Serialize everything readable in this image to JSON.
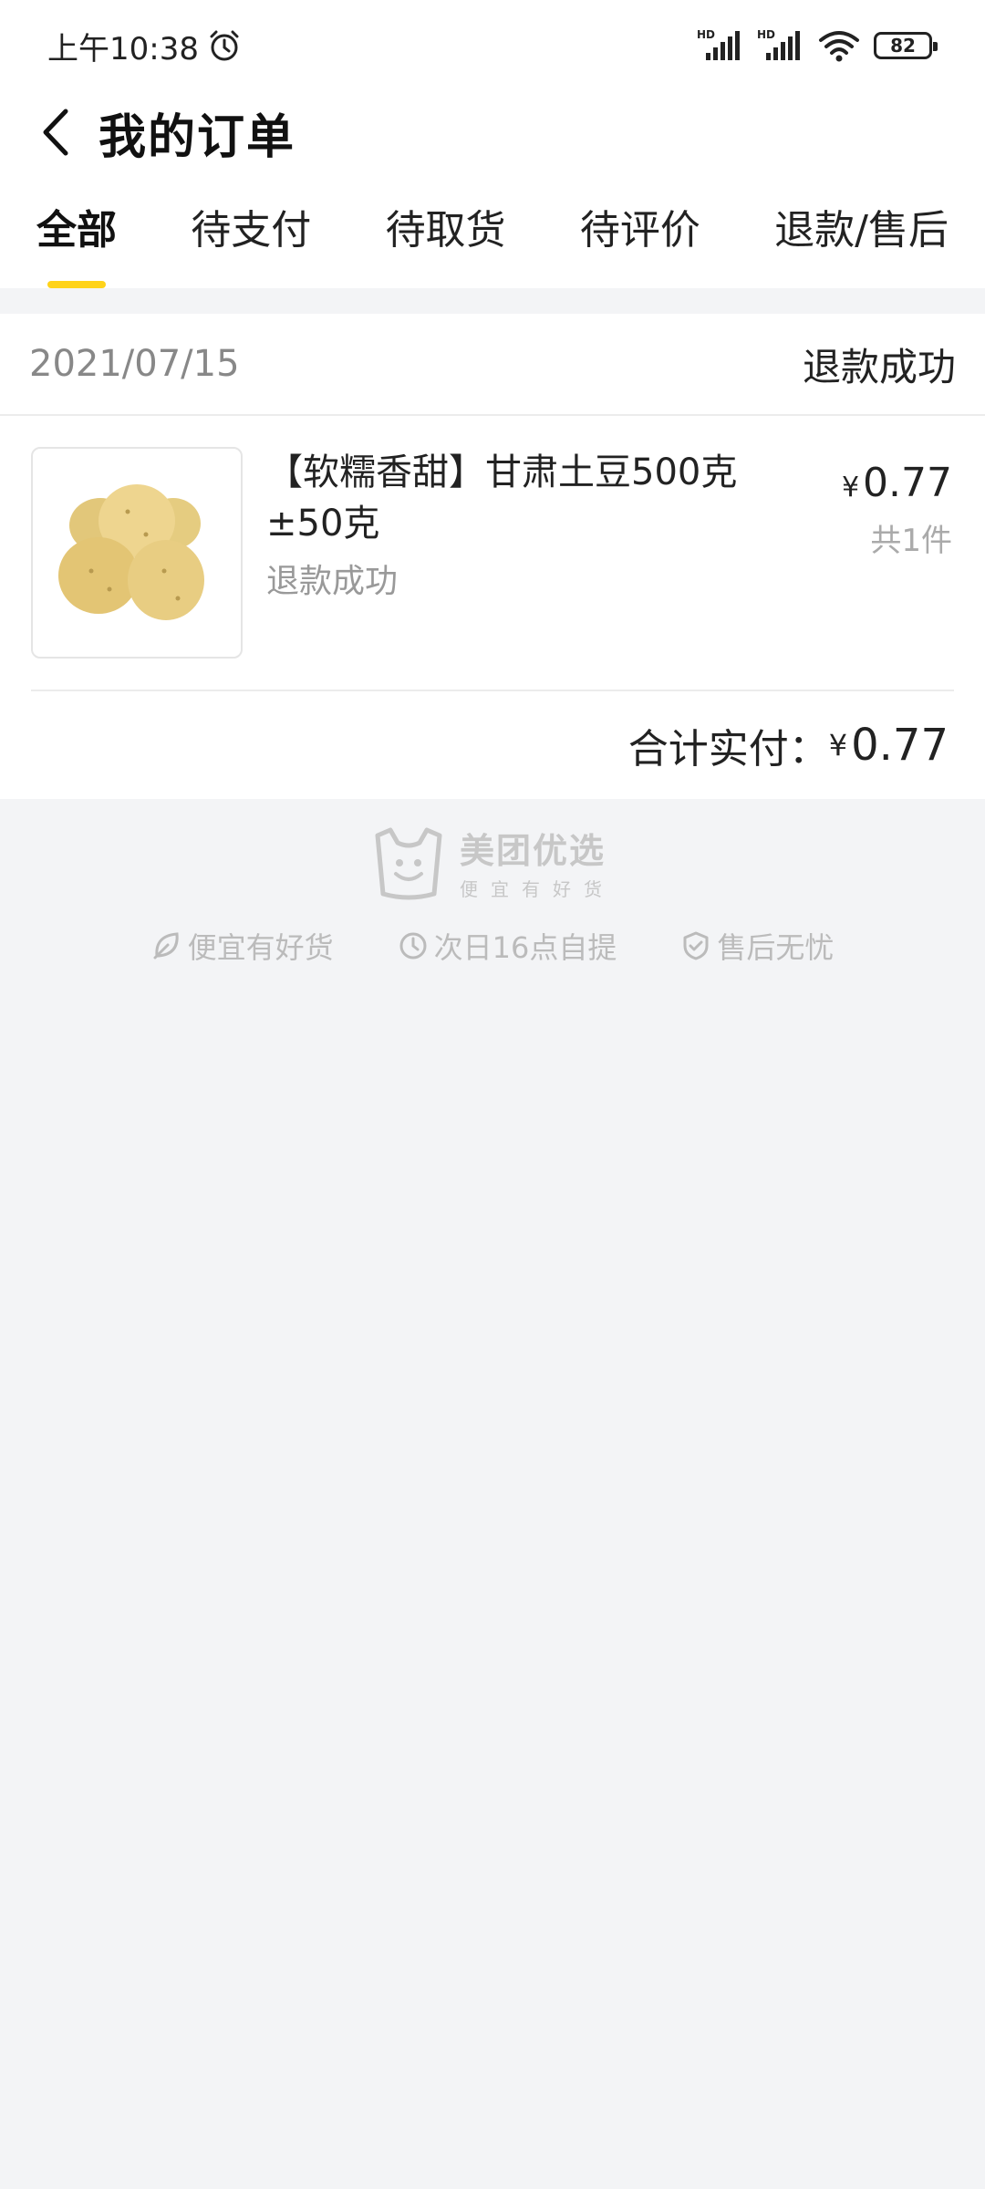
{
  "status_bar": {
    "time": "上午10:38",
    "battery": "82"
  },
  "header": {
    "title": "我的订单"
  },
  "tabs": [
    {
      "label": "全部"
    },
    {
      "label": "待支付"
    },
    {
      "label": "待取货"
    },
    {
      "label": "待评价"
    },
    {
      "label": "退款/售后"
    }
  ],
  "order": {
    "date": "2021/07/15",
    "status": "退款成功",
    "item": {
      "name": "【软糯香甜】甘肃土豆500克±50克",
      "sub_status": "退款成功",
      "currency": "¥",
      "price": "0.77",
      "quantity": "共1件"
    },
    "total_label": "合计实付：",
    "total_currency": "¥",
    "total_value": "0.77"
  },
  "footer": {
    "brand_name": "美团优选",
    "brand_slogan": "便宜有好货",
    "features": [
      {
        "label": "便宜有好货",
        "icon": "leaf-icon"
      },
      {
        "label": "次日16点自提",
        "icon": "clock-icon"
      },
      {
        "label": "售后无忧",
        "icon": "shield-icon"
      }
    ]
  },
  "colors": {
    "accent": "#ffd31a",
    "background": "#f3f4f6"
  }
}
